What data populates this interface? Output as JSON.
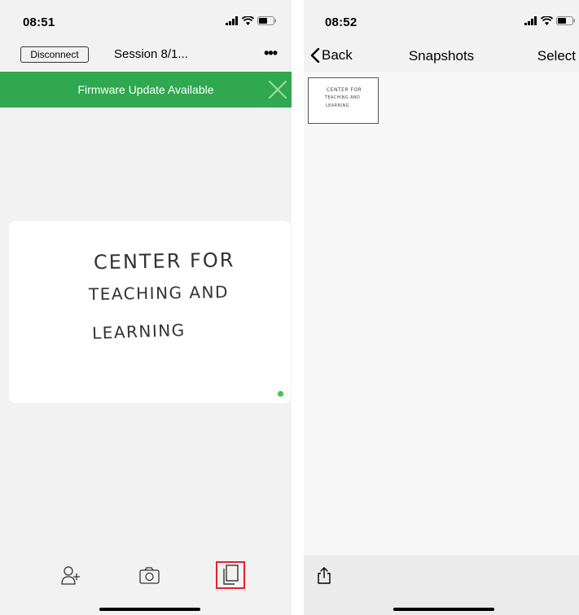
{
  "left_screen": {
    "status_time": "08:51",
    "disconnect_label": "Disconnect",
    "session_title": "Session 8/1...",
    "more_label": "•••",
    "banner_text": "Firmware Update Available",
    "board_lines": [
      "CENTER FOR",
      "TEACHING AND",
      "LEARNING"
    ],
    "toolbar_icons": [
      "add-person-icon",
      "camera-icon",
      "snapshots-icon"
    ],
    "accent_colors": {
      "banner": "#2fa84f",
      "live_dot": "#35c759",
      "highlight": "#e8202a"
    }
  },
  "right_screen": {
    "status_time": "08:52",
    "back_label": "Back",
    "title": "Snapshots",
    "select_label": "Select",
    "snapshots": [
      {
        "lines": [
          "CENTER FOR",
          "TEACHING AND",
          "LEARNING"
        ]
      }
    ],
    "toolbar_icons": [
      "share-icon"
    ]
  }
}
